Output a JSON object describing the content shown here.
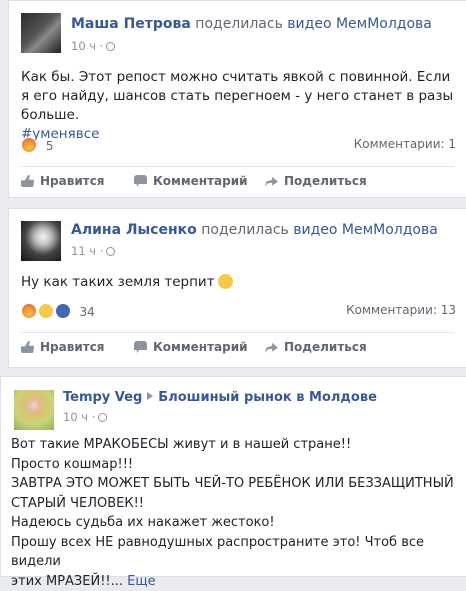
{
  "post1": {
    "author": "Маша Петрова",
    "action": "поделилась",
    "link": "видео МемМолдова",
    "time": "10 ч ·",
    "text": "Как бы. Этот репост можно считать явкой с повинной. Если я его найду, шансов стать перегноем - у него станет в разы больше.",
    "hashtag": "#уменявсе",
    "reactions_count": "5",
    "comments": "Комментарии: 1"
  },
  "post2": {
    "author": "Алина Лысенко",
    "action": "поделилась",
    "link": "видео МемМолдова",
    "time": "11 ч ·",
    "text": "Ну как таких земля терпит",
    "reactions_count": "34",
    "comments": "Комментарии: 13"
  },
  "post3": {
    "author": "Tempy Veg",
    "group": "Блошиный рынок в Молдове",
    "time": "10 ч ·",
    "lines": [
      "Вот такие МРАКОБЕСЫ живут и в нашей стране!!",
      "Просто кошмар!!!",
      "ЗАВТРА ЭТО МОЖЕТ БЫТЬ ЧЕЙ-ТО РЕБЁНОК ИЛИ БЕЗЗАЩИТНЫЙ",
      "СТАРЫЙ ЧЕЛОВЕК!!",
      "Надеюсь судьба их накажет жестоко!",
      "Прошу всех НЕ равнодушных распространите это! Чтоб все видели",
      "этих МРАЗЕЙ!!..."
    ],
    "more": "Еще"
  },
  "actions": {
    "like": "Нравится",
    "comment": "Комментарий",
    "share": "Поделиться"
  },
  "icons": [
    "globe-icon",
    "angry-reaction-icon",
    "sad-reaction-icon",
    "like-reaction-icon",
    "thumb-up-icon",
    "comment-bubble-icon",
    "share-arrow-icon",
    "triangle-right-icon",
    "sad-emoji-icon"
  ],
  "colors": {
    "link": "#365899",
    "background": "#e9ebee",
    "meta": "#90949c"
  }
}
